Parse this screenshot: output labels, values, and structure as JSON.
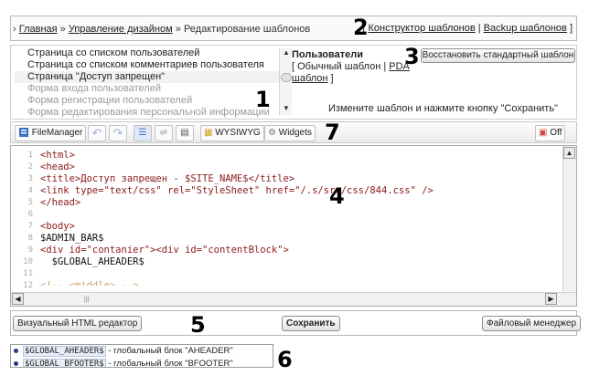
{
  "breadcrumb": {
    "home": "Главная",
    "section": "Управление дизайном",
    "current": "Редактирование шаблонов",
    "sep": "»",
    "designer_link": "Конструктор шаблонов",
    "backup_link": "Backup шаблонов"
  },
  "markers": [
    "1",
    "2",
    "3",
    "4",
    "5",
    "6",
    "7"
  ],
  "templates": {
    "items": [
      {
        "label": "Страница со списком пользователей",
        "state": "normal"
      },
      {
        "label": "Страница со списком комментариев пользователя",
        "state": "normal"
      },
      {
        "label": "Страница \"Доступ запрещен\"",
        "state": "selected"
      },
      {
        "label": "Форма входа пользователей",
        "state": "dim"
      },
      {
        "label": "Форма регистрации пользователей",
        "state": "dim"
      },
      {
        "label": "Форма редактирования персональной информации",
        "state": "dim"
      }
    ]
  },
  "users_panel": {
    "title": "Пользователи",
    "normal": "[ Обычный шаблон |",
    "pda": "PDA шаблон",
    "close": "]"
  },
  "restore_button": "Восстановить стандартный шаблон",
  "hint": "Измените шаблон и нажмите кнопку \"Сохранить\"",
  "toolbar": {
    "filemanager": "FileManager",
    "wysiwyg": "WYSIWYG",
    "widgets": "Widgets",
    "off": "Off"
  },
  "code": {
    "line_numbers": [
      "1",
      "2",
      "3",
      "4",
      "5",
      "6",
      "7",
      "8",
      "9",
      "10",
      "11",
      "12"
    ],
    "lines": [
      "<html>",
      "<head>",
      "<title>Доступ запрещен - $SITE_NAME$</title>",
      "<link type=\"text/css\" rel=\"StyleSheet\" href=\"/.s/src/css/844.css\" />",
      "</head>",
      "",
      "<body>",
      "$ADMIN_BAR$",
      "<div id=\"contanier\"><div id=\"contentBlock\">",
      "  $GLOBAL_AHEADER$",
      "",
      "<!-- <middle> -->"
    ]
  },
  "actions": {
    "visual_editor": "Визуальный HTML редактор",
    "save": "Сохранить",
    "file_manager": "Файловый менеджер"
  },
  "variables": [
    {
      "name": "$GLOBAL_AHEADER$",
      "desc": "- глобальный блок \"AHEADER\""
    },
    {
      "name": "$GLOBAL_BFOOTER$",
      "desc": "- глобальный блок \"BFOOTER\""
    }
  ],
  "colors": {
    "tag": "#8b1a1a",
    "string": "#1c2fb0",
    "variable_dot": "#1f3c88"
  }
}
